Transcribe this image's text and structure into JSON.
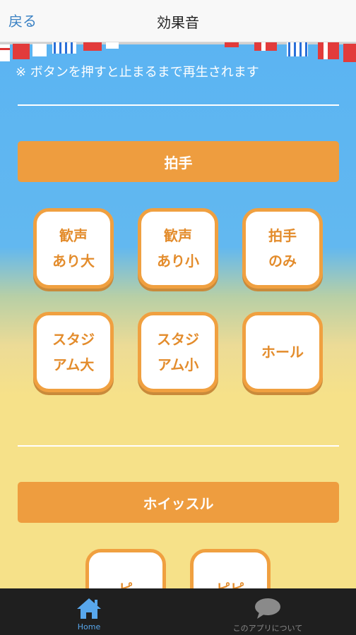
{
  "header": {
    "back_label": "戻る",
    "title": "効果音"
  },
  "notice": "※ ボタンを押すと止まるまで再生されます",
  "sections": [
    {
      "title": "拍手",
      "buttons": [
        {
          "line1": "歓声",
          "line2": "あり大"
        },
        {
          "line1": "歓声",
          "line2": "あり小"
        },
        {
          "line1": "拍手",
          "line2": "のみ"
        },
        {
          "line1": "スタジ",
          "line2": "アム大"
        },
        {
          "line1": "スタジ",
          "line2": "アム小"
        },
        {
          "line1": "ホール",
          "line2": ""
        }
      ]
    },
    {
      "title": "ホイッスル",
      "buttons": [
        {
          "line1": "ピ",
          "line2": ""
        },
        {
          "line1": "ピピ",
          "line2": ""
        }
      ]
    }
  ],
  "tabbar": {
    "home_label": "Home",
    "about_label": "このアプリについて"
  },
  "colors": {
    "accent_orange": "#ee9d3f",
    "button_border": "#f0a040",
    "button_text": "#e38c2c",
    "sky_blue": "#5bb4f2",
    "sand_yellow": "#f6e189",
    "link_blue": "#3b82c4",
    "tab_active": "#58a7ec"
  },
  "icons": {
    "home": "home-icon",
    "about": "speech-bubble-icon"
  }
}
